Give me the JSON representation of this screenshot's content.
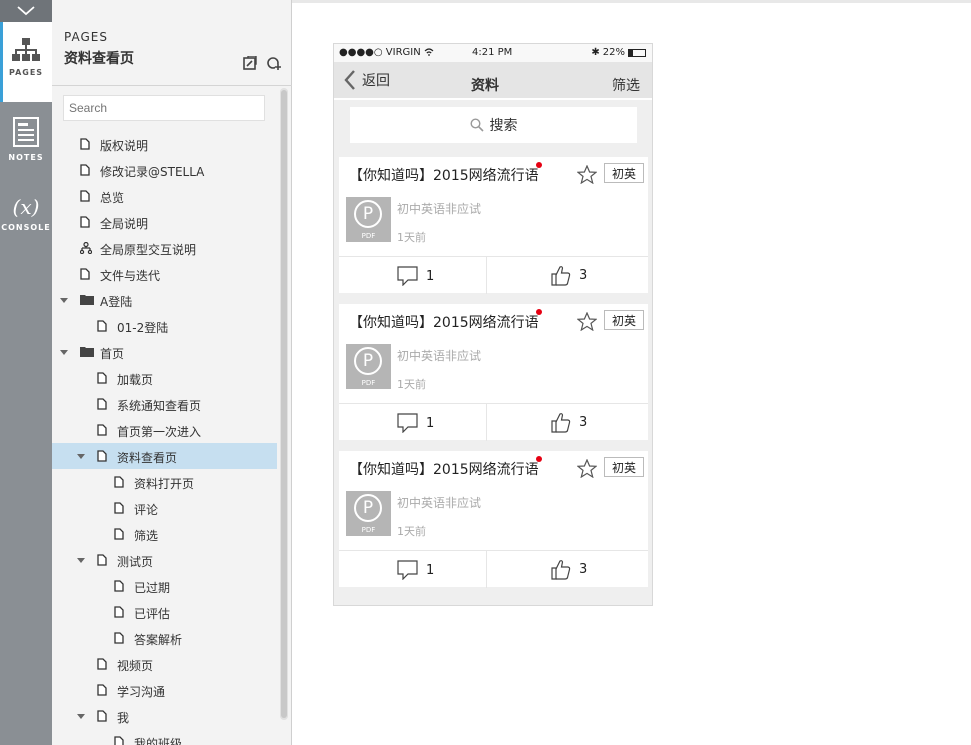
{
  "rail": {
    "pages_label": "PAGES",
    "notes_label": "NOTES",
    "console_label": "CONSOLE",
    "console_glyph": "(x)"
  },
  "panel": {
    "caption": "PAGES",
    "title": "资料查看页",
    "search_placeholder": "Search"
  },
  "tree": [
    {
      "label": "版权说明",
      "depth": 0,
      "icon": "page-icon",
      "arrow": false
    },
    {
      "label": "修改记录@STELLA",
      "depth": 0,
      "icon": "page-icon",
      "arrow": false
    },
    {
      "label": "总览",
      "depth": 0,
      "icon": "page-icon",
      "arrow": false
    },
    {
      "label": "全局说明",
      "depth": 0,
      "icon": "page-icon",
      "arrow": false
    },
    {
      "label": "全局原型交互说明",
      "depth": 0,
      "icon": "flow-icon",
      "arrow": false
    },
    {
      "label": "文件与迭代",
      "depth": 0,
      "icon": "page-icon",
      "arrow": false
    },
    {
      "label": "A登陆",
      "depth": 0,
      "icon": "folder-icon",
      "arrow": true
    },
    {
      "label": "01-2登陆",
      "depth": 1,
      "icon": "page-icon",
      "arrow": false
    },
    {
      "label": "首页",
      "depth": 0,
      "icon": "folder-icon",
      "arrow": true
    },
    {
      "label": "加载页",
      "depth": 1,
      "icon": "page-icon",
      "arrow": false
    },
    {
      "label": "系统通知查看页",
      "depth": 1,
      "icon": "page-icon",
      "arrow": false
    },
    {
      "label": "首页第一次进入",
      "depth": 1,
      "icon": "page-icon",
      "arrow": false
    },
    {
      "label": "资料查看页",
      "depth": 1,
      "icon": "page-icon",
      "arrow": true,
      "selected": true
    },
    {
      "label": "资料打开页",
      "depth": 2,
      "icon": "page-icon",
      "arrow": false
    },
    {
      "label": "评论",
      "depth": 2,
      "icon": "page-icon",
      "arrow": false
    },
    {
      "label": "筛选",
      "depth": 2,
      "icon": "page-icon",
      "arrow": false
    },
    {
      "label": "测试页",
      "depth": 1,
      "icon": "page-icon",
      "arrow": true
    },
    {
      "label": "已过期",
      "depth": 2,
      "icon": "page-icon",
      "arrow": false
    },
    {
      "label": "已评估",
      "depth": 2,
      "icon": "page-icon",
      "arrow": false
    },
    {
      "label": "答案解析",
      "depth": 2,
      "icon": "page-icon",
      "arrow": false
    },
    {
      "label": "视频页",
      "depth": 1,
      "icon": "page-icon",
      "arrow": false
    },
    {
      "label": "学习沟通",
      "depth": 1,
      "icon": "page-icon",
      "arrow": false
    },
    {
      "label": "我",
      "depth": 1,
      "icon": "page-icon",
      "arrow": true
    },
    {
      "label": "我的班级",
      "depth": 2,
      "icon": "page-icon",
      "arrow": false
    }
  ],
  "phone": {
    "carrier": "●●●●○ VIRGIN",
    "time": "4:21 PM",
    "battery": "22%",
    "back_label": "返回",
    "title": "资料",
    "filter_label": "筛选",
    "search_label": "搜索",
    "cards": [
      {
        "title": "【你知道吗】2015网络流行语",
        "tag": "初英",
        "thumb_letter": "P",
        "thumb_type": "PDF",
        "subtitle": "初中英语非应试",
        "time": "1天前",
        "comments": "1",
        "likes": "3"
      },
      {
        "title": "【你知道吗】2015网络流行语",
        "tag": "初英",
        "thumb_letter": "P",
        "thumb_type": "PDF",
        "subtitle": "初中英语非应试",
        "time": "1天前",
        "comments": "1",
        "likes": "3"
      },
      {
        "title": "【你知道吗】2015网络流行语",
        "tag": "初英",
        "thumb_letter": "P",
        "thumb_type": "PDF",
        "subtitle": "初中英语非应试",
        "time": "1天前",
        "comments": "1",
        "likes": "3"
      }
    ]
  }
}
